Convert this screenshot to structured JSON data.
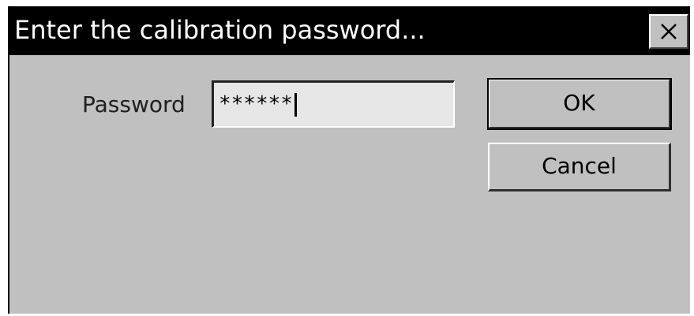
{
  "dialog": {
    "title": "Enter the calibration password...",
    "close_icon": "close-icon",
    "password_label": "Password",
    "password_value": "******",
    "ok_label": "OK",
    "cancel_label": "Cancel"
  },
  "colors": {
    "titlebar": "#000000",
    "dialog_bg": "#c0c0c0",
    "input_bg": "#e6e6e6"
  }
}
